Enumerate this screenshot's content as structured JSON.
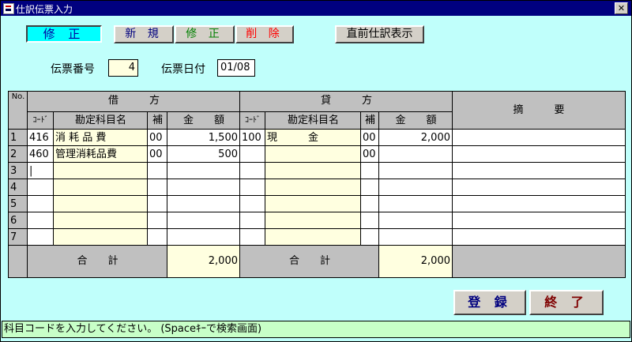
{
  "window": {
    "title": "仕訳伝票入力",
    "close_glyph": "✕"
  },
  "mode_label": "修 正",
  "buttons": {
    "new": "新 規",
    "modify": "修 正",
    "delete": "削 除",
    "prev": "直前仕訳表示",
    "register": "登 録",
    "end": "終 了"
  },
  "slip": {
    "number_label": "伝票番号",
    "number": "4",
    "date_label": "伝票日付",
    "date": "01/08"
  },
  "table": {
    "no_header": "No.",
    "debit_header": "借　　　方",
    "credit_header": "貸　　　方",
    "memo_header": "摘　　　要",
    "code_header": "ｺｰﾄﾞ",
    "account_header": "勘定科目名",
    "sub_header": "補",
    "amount_header": "金　　額",
    "rows": [
      {
        "no": "1",
        "d_code": "416",
        "d_name": "消 耗 品 費",
        "d_sub": "00",
        "d_amount": "1,500",
        "c_code": "100",
        "c_name": "現　　　金",
        "c_sub": "00",
        "c_amount": "2,000",
        "memo": ""
      },
      {
        "no": "2",
        "d_code": "460",
        "d_name": "管理消耗品費",
        "d_sub": "00",
        "d_amount": "500",
        "c_code": "",
        "c_name": "",
        "c_sub": "00",
        "c_amount": "",
        "memo": ""
      },
      {
        "no": "3",
        "d_code": "|",
        "d_name": "",
        "d_sub": "",
        "d_amount": "",
        "c_code": "",
        "c_name": "",
        "c_sub": "",
        "c_amount": "",
        "memo": ""
      },
      {
        "no": "4",
        "d_code": "",
        "d_name": "",
        "d_sub": "",
        "d_amount": "",
        "c_code": "",
        "c_name": "",
        "c_sub": "",
        "c_amount": "",
        "memo": ""
      },
      {
        "no": "5",
        "d_code": "",
        "d_name": "",
        "d_sub": "",
        "d_amount": "",
        "c_code": "",
        "c_name": "",
        "c_sub": "",
        "c_amount": "",
        "memo": ""
      },
      {
        "no": "6",
        "d_code": "",
        "d_name": "",
        "d_sub": "",
        "d_amount": "",
        "c_code": "",
        "c_name": "",
        "c_sub": "",
        "c_amount": "",
        "memo": ""
      },
      {
        "no": "7",
        "d_code": "",
        "d_name": "",
        "d_sub": "",
        "d_amount": "",
        "c_code": "",
        "c_name": "",
        "c_sub": "",
        "c_amount": "",
        "memo": ""
      }
    ],
    "total_label": "合　　計",
    "debit_total": "2,000",
    "credit_total": "2,000"
  },
  "status_text": "科目コードを入力してください。 (Spaceｷｰで検索画面)",
  "colors": {
    "window_bg": "#c0fffb",
    "titlebar": "#00007f",
    "account_cell": "#ffffe0",
    "header_gray": "#c0c0c0",
    "status_bg": "#c8ffc8"
  }
}
